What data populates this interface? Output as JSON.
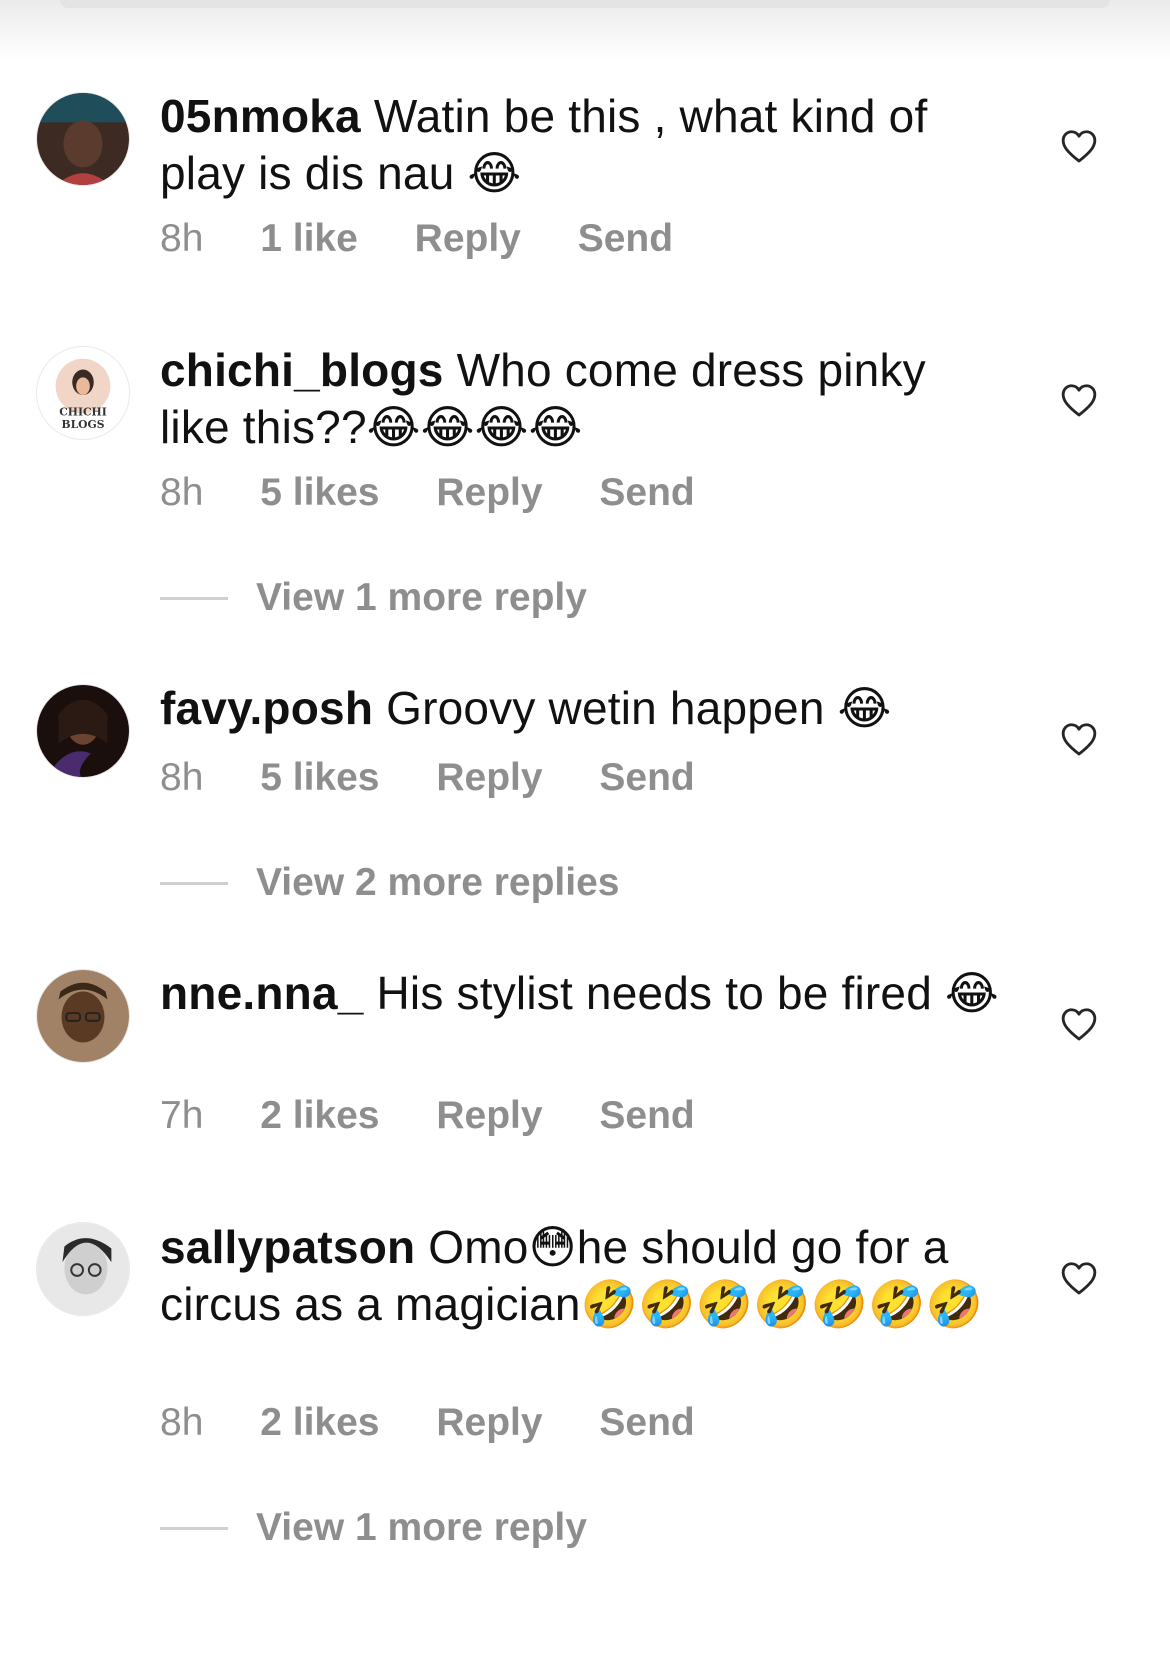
{
  "comments": [
    {
      "username": "05nmoka",
      "text": "Watin be this , what kind of play is dis nau 😂",
      "time": "8h",
      "likes": "1 like",
      "reply_label": "Reply",
      "send_label": "Send",
      "avatar_colors": [
        "#5a3b2e",
        "#1f4e5a"
      ]
    },
    {
      "username": "chichi_blogs",
      "text": "Who come dress pinky like this??😂😂😂😂",
      "time": "8h",
      "likes": "5 likes",
      "reply_label": "Reply",
      "send_label": "Send",
      "view_replies": "View 1 more reply",
      "avatar_line1": "CHICHI",
      "avatar_line2": "BLOGS",
      "avatar_colors": [
        "#f1d6c7",
        "#3a2a26"
      ]
    },
    {
      "username": "favy.posh",
      "text": "Groovy wetin happen 😂",
      "time": "8h",
      "likes": "5 likes",
      "reply_label": "Reply",
      "send_label": "Send",
      "view_replies": "View 2 more replies",
      "avatar_colors": [
        "#2b1a14",
        "#4a2b6e"
      ]
    },
    {
      "username": "nne.nna_",
      "text": "His stylist needs to be fired 😂",
      "time": "7h",
      "likes": "2 likes",
      "reply_label": "Reply",
      "send_label": "Send",
      "avatar_colors": [
        "#8a6a4a",
        "#5a3a22"
      ]
    },
    {
      "username": "sallypatson",
      "text": "Omo😳he should go for a circus as a magician🤣🤣🤣🤣🤣🤣🤣",
      "time": "8h",
      "likes": "2 likes",
      "reply_label": "Reply",
      "send_label": "Send",
      "view_replies": "View 1 more reply",
      "avatar_colors": [
        "#e8e8e8",
        "#2a2a2a"
      ]
    }
  ],
  "colors": {
    "text": "#111111",
    "meta": "#8e8e8e",
    "divider": "#d0d0d0",
    "background": "#ffffff"
  },
  "icons": {
    "like": "heart-outline-icon"
  }
}
